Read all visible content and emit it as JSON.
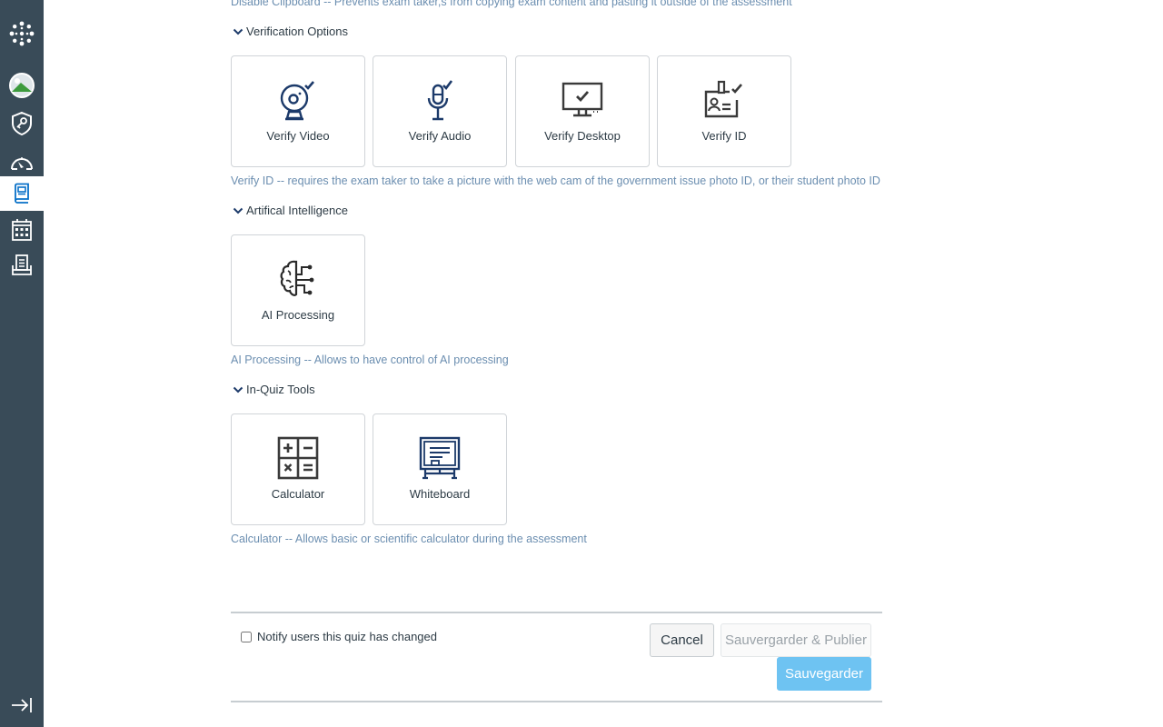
{
  "nav": {
    "items": [
      {
        "name": "logo",
        "active": false
      },
      {
        "name": "account",
        "active": false
      },
      {
        "name": "admin",
        "active": false
      },
      {
        "name": "dashboard",
        "active": false
      },
      {
        "name": "courses",
        "active": true
      },
      {
        "name": "calendar",
        "active": false
      },
      {
        "name": "inbox",
        "active": false
      }
    ],
    "collapse_icon": "collapse-arrow-icon"
  },
  "top_help": "Disable Clipboard -- Prevents exam taker,s from copying exam content and pasting it outside of the assessment",
  "sections": [
    {
      "title": "Verification Options",
      "tiles": [
        {
          "label": "Verify Video",
          "icon": "webcam-check-icon"
        },
        {
          "label": "Verify Audio",
          "icon": "microphone-check-icon"
        },
        {
          "label": "Verify Desktop",
          "icon": "monitor-check-icon"
        },
        {
          "label": "Verify ID",
          "icon": "id-badge-check-icon"
        }
      ],
      "help": "Verify ID -- requires the exam taker to take a picture with the web cam of the government issue photo ID, or their student photo ID"
    },
    {
      "title": "Artifical Intelligence",
      "tiles": [
        {
          "label": "AI Processing",
          "icon": "brain-circuit-icon"
        }
      ],
      "help": "AI Processing -- Allows to have control of AI processing"
    },
    {
      "title": "In-Quiz Tools",
      "tiles": [
        {
          "label": "Calculator",
          "icon": "calculator-icon"
        },
        {
          "label": "Whiteboard",
          "icon": "whiteboard-icon"
        }
      ],
      "help": "Calculator -- Allows basic or scientific calculator during the assessment"
    }
  ],
  "footer": {
    "notify_label": "Notify users this quiz has changed",
    "notify_checked": false,
    "cancel": "Cancel",
    "save_publish": "Sauvergarder & Publier",
    "save": "Sauvegarder"
  },
  "colors": {
    "nav_bg": "#394b58",
    "accent": "#0770c8",
    "help_text": "#6b8eb0",
    "save_button": "#6ec3f2",
    "icon_navy": "#1c3a6a",
    "icon_gray": "#3a3a3a"
  }
}
